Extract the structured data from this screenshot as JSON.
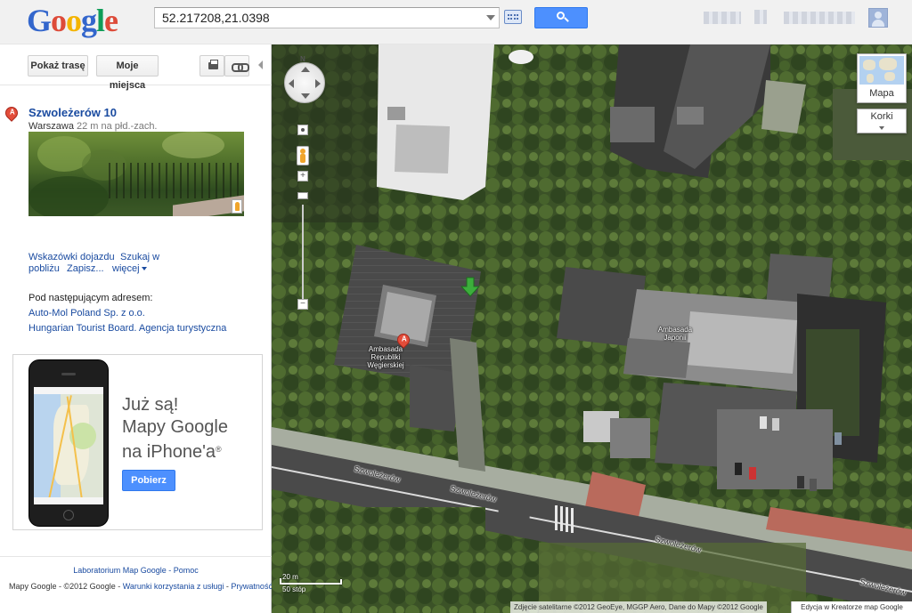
{
  "header": {
    "logo_letters": [
      {
        "ch": "G",
        "color": "#3366cc"
      },
      {
        "ch": "o",
        "color": "#dd4b39"
      },
      {
        "ch": "o",
        "color": "#f4b400"
      },
      {
        "ch": "g",
        "color": "#3366cc"
      },
      {
        "ch": "l",
        "color": "#0f9d58"
      },
      {
        "ch": "e",
        "color": "#dd4b39"
      }
    ],
    "search_value": "52.217208,21.0398",
    "search_icon": "magnifier-icon",
    "keyboard_icon": "keyboard-icon"
  },
  "panel": {
    "route_button": "Pokaż trasę",
    "my_places_button": "Moje miejsca",
    "result": {
      "marker": "A",
      "title": "Szwoleżerów 10",
      "city": "Warszawa",
      "distance": "22 m na płd.-zach."
    },
    "actions": {
      "directions": "Wskazówki dojazdu",
      "search_nearby_1": "Szukaj w",
      "search_nearby_2": "pobliżu",
      "save": "Zapisz...",
      "more": "więcej"
    },
    "addresses_heading": "Pod następującym adresem:",
    "addresses": [
      "Auto-Mol Poland Sp. z o.o.",
      "Hungarian Tourist Board. Agencja turystyczna"
    ],
    "ad": {
      "line1": "Już są!",
      "line2": "Mapy Google",
      "line3": "na iPhone'a",
      "reg": "®",
      "button": "Pobierz"
    },
    "footer": {
      "lab": "Laboratorium Map Google",
      "sep": " - ",
      "help": "Pomoc",
      "copyright": "Mapy Google - ©2012 Google - ",
      "terms": "Warunki korzystania z usługi",
      "dash": " - ",
      "privacy": "Prywatność"
    }
  },
  "map": {
    "marker": "A",
    "labels": {
      "hungary": [
        "Ambasada",
        "Republiki",
        "Węgierskiej"
      ],
      "japan": [
        "Ambasada",
        "Japonii"
      ]
    },
    "streets": [
      "Szwoleżerów",
      "Szwoleżerów",
      "Szwoleżerów",
      "Szwoleżerów"
    ],
    "compass": "N",
    "map_type": "Mapa",
    "layers": "Korki",
    "scale_m": "20 m",
    "scale_ft": "50 stóp",
    "attribution": "Zdjęcie satelitarne ©2012 GeoEye, MGGP Aero, Dane do Mapy ©2012 Google",
    "mapmaker": "Edycja w Kreatorze map Google"
  }
}
